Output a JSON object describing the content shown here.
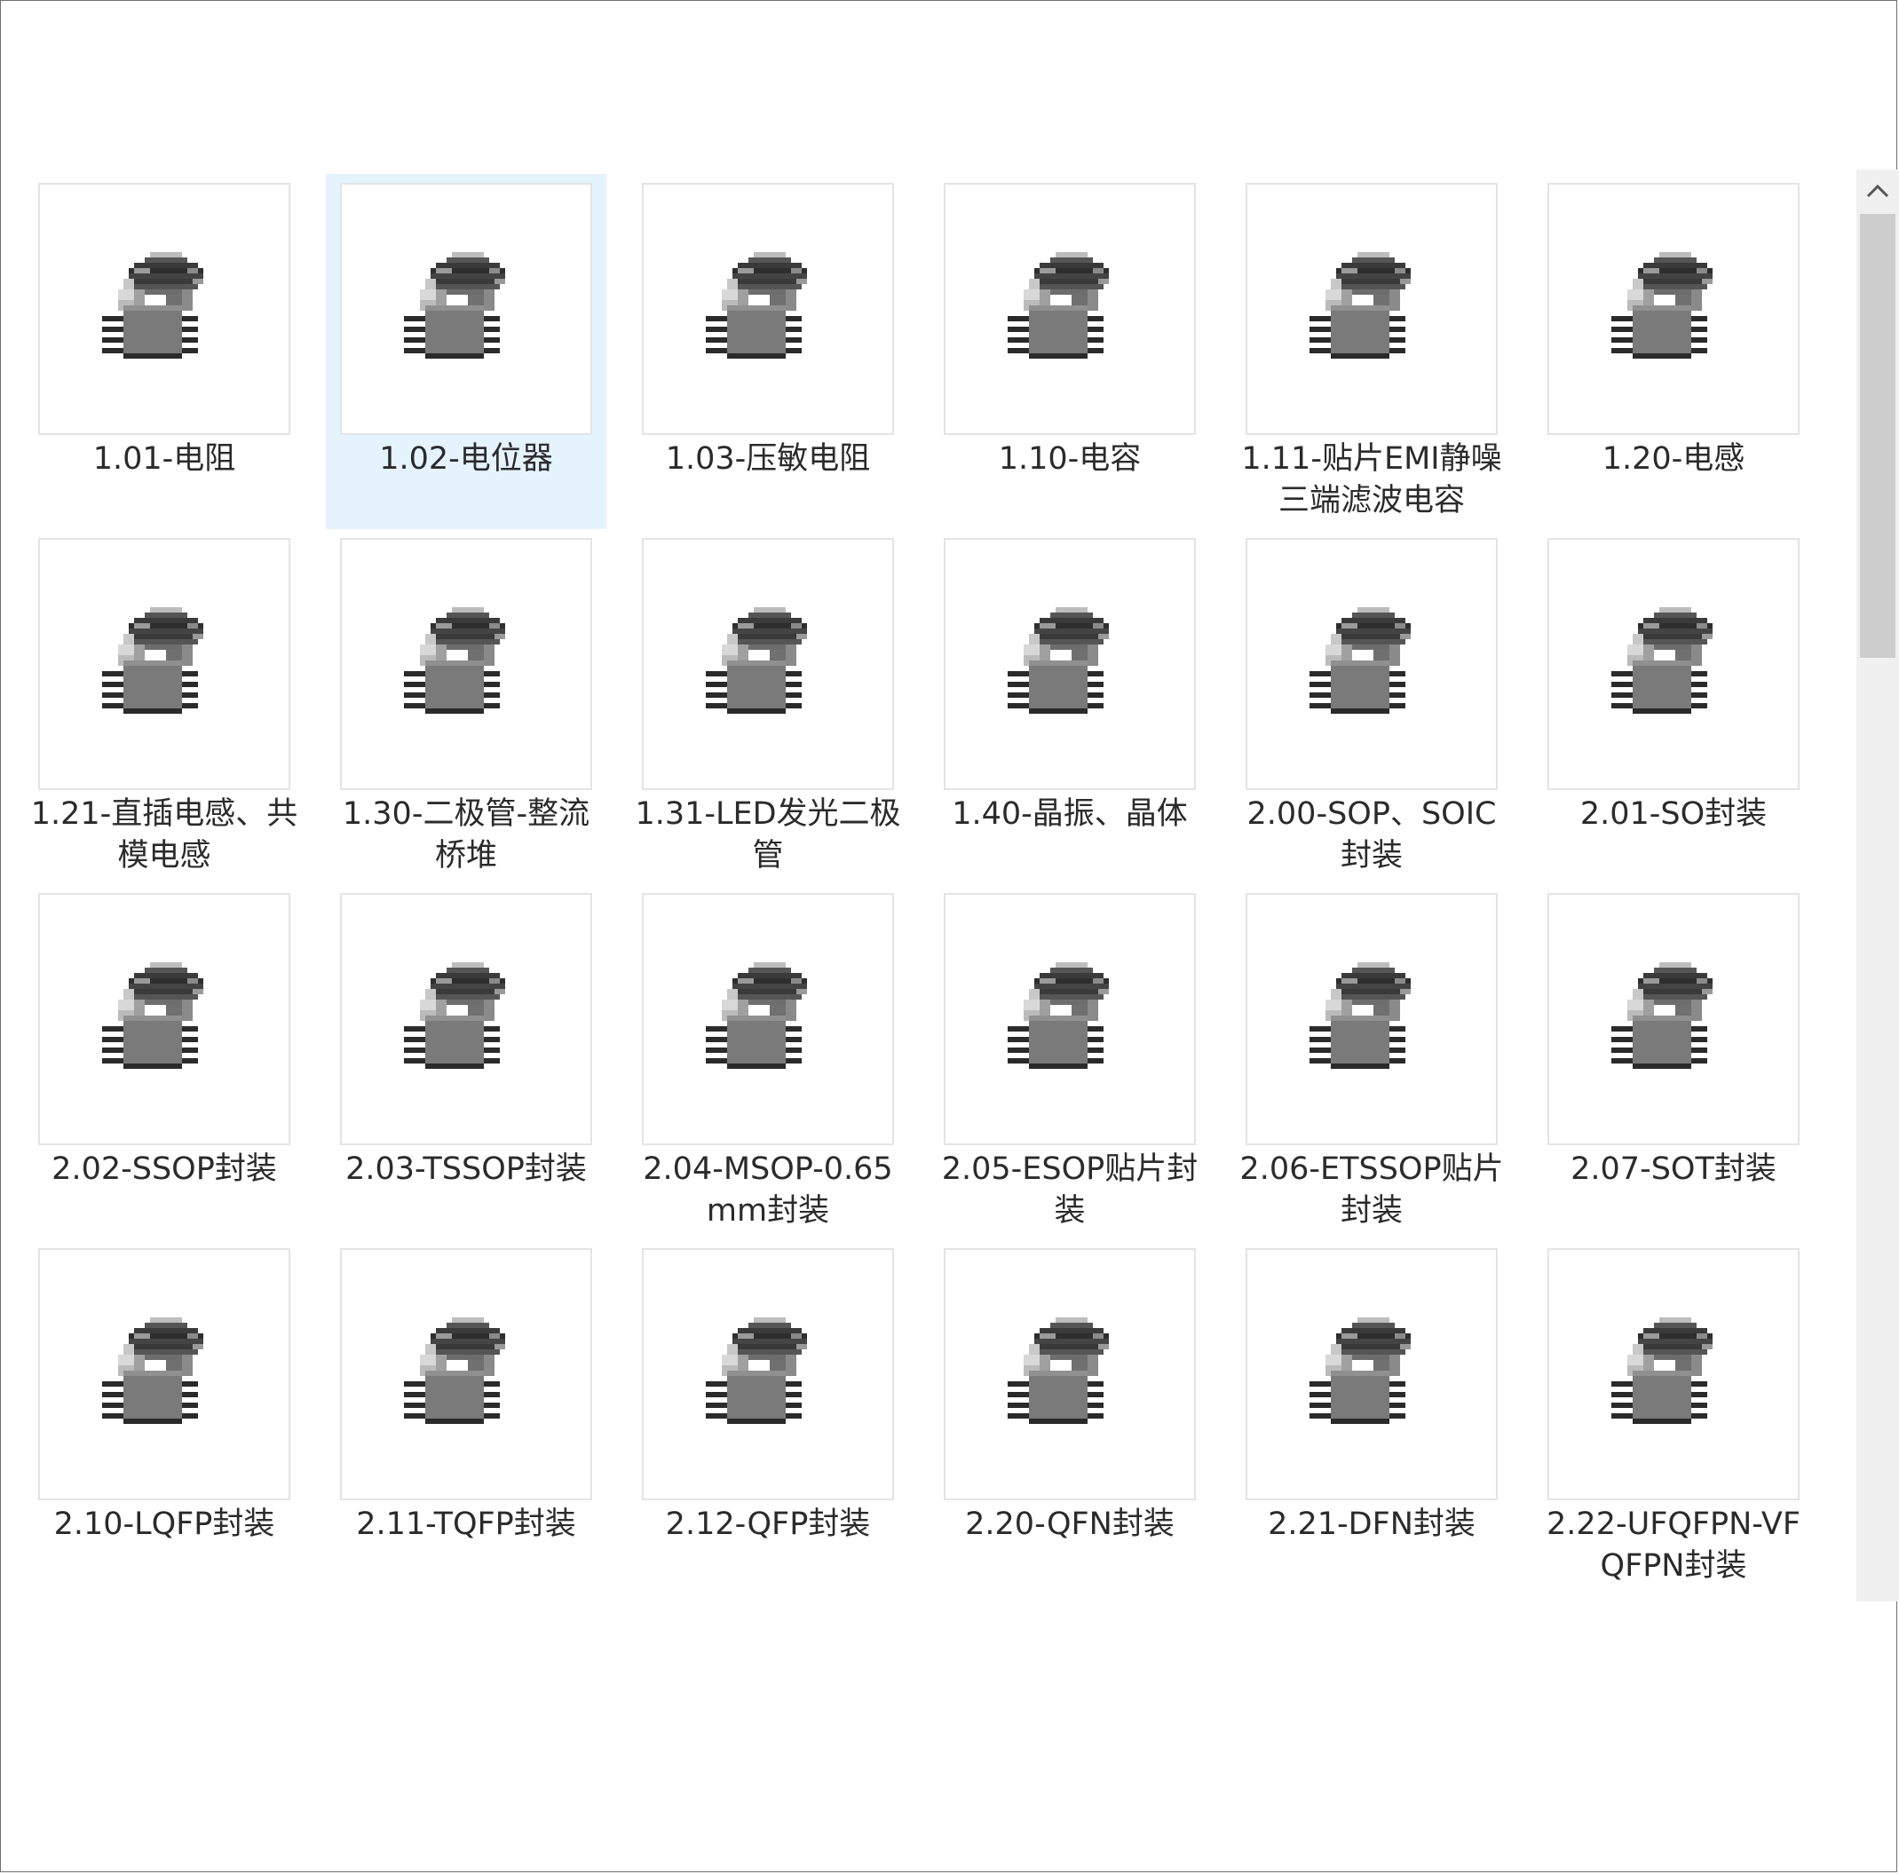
{
  "colors": {
    "selection": "#e5f3ff",
    "thumb_border": "#e4e4e4",
    "text": "#2b2b2b",
    "scroll_track": "#f0f0f0",
    "scroll_thumb": "#cdcdcd"
  },
  "icon": "chip-package-icon",
  "selected_index": 1,
  "items": [
    {
      "label": "1.01-电阻"
    },
    {
      "label": "1.02-电位器"
    },
    {
      "label": "1.03-压敏电阻"
    },
    {
      "label": "1.10-电容"
    },
    {
      "label": "1.11-贴片EMI静噪三端滤波电容"
    },
    {
      "label": "1.20-电感"
    },
    {
      "label": "1.21-直插电感、共模电感"
    },
    {
      "label": "1.30-二极管-整流桥堆"
    },
    {
      "label": "1.31-LED发光二极管"
    },
    {
      "label": "1.40-晶振、晶体"
    },
    {
      "label": "2.00-SOP、SOIC封装"
    },
    {
      "label": "2.01-SO封装"
    },
    {
      "label": "2.02-SSOP封装"
    },
    {
      "label": "2.03-TSSOP封装"
    },
    {
      "label": "2.04-MSOP-0.65mm封装"
    },
    {
      "label": "2.05-ESOP贴片封装"
    },
    {
      "label": "2.06-ETSSOP贴片封装"
    },
    {
      "label": "2.07-SOT封装"
    },
    {
      "label": "2.10-LQFP封装"
    },
    {
      "label": "2.11-TQFP封装"
    },
    {
      "label": "2.12-QFP封装"
    },
    {
      "label": "2.20-QFN封装"
    },
    {
      "label": "2.21-DFN封装"
    },
    {
      "label": "2.22-UFQFPN-VFQFPN封装"
    }
  ],
  "scrollbar": {
    "up_icon": "chevron-up-icon"
  }
}
